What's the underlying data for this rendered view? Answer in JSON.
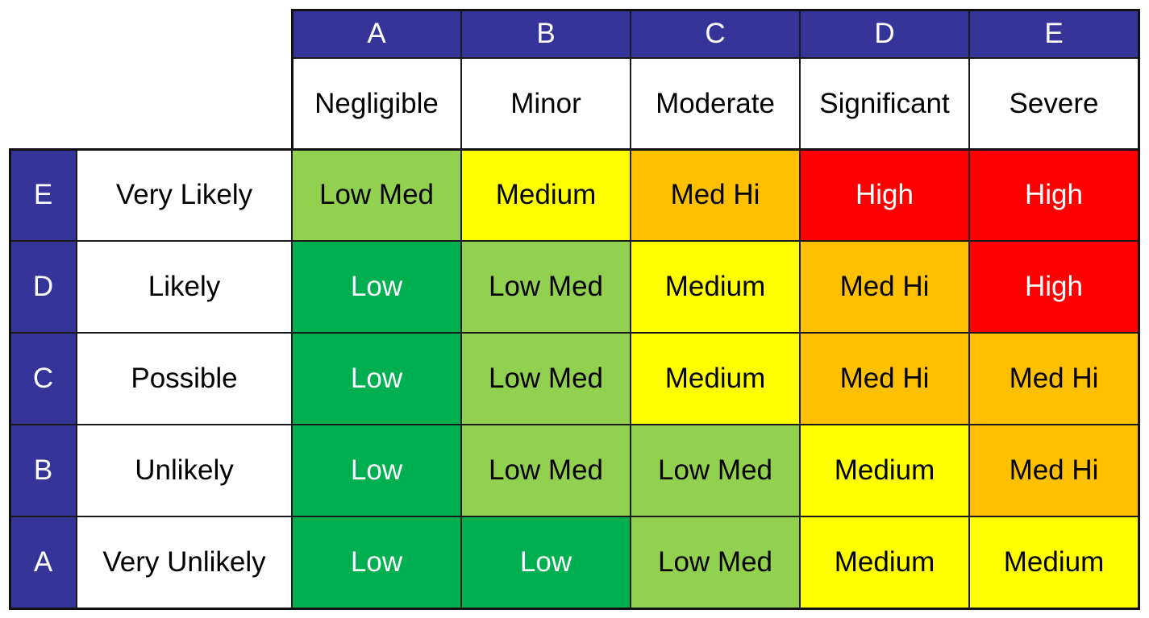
{
  "matrix": {
    "impact_codes": [
      "A",
      "B",
      "C",
      "D",
      "E"
    ],
    "impact_labels": [
      "Negligible",
      "Minor",
      "Moderate",
      "Significant",
      "Severe"
    ],
    "likelihood_rows": [
      {
        "code": "E",
        "label": "Very Likely",
        "cells": [
          "Low Med",
          "Medium",
          "Med Hi",
          "High",
          "High"
        ]
      },
      {
        "code": "D",
        "label": "Likely",
        "cells": [
          "Low",
          "Low Med",
          "Medium",
          "Med Hi",
          "High"
        ]
      },
      {
        "code": "C",
        "label": "Possible",
        "cells": [
          "Low",
          "Low Med",
          "Medium",
          "Med Hi",
          "Med Hi"
        ]
      },
      {
        "code": "B",
        "label": "Unlikely",
        "cells": [
          "Low",
          "Low Med",
          "Low Med",
          "Medium",
          "Med Hi"
        ]
      },
      {
        "code": "A",
        "label": "Very Unlikely",
        "cells": [
          "Low",
          "Low",
          "Low Med",
          "Medium",
          "Medium"
        ]
      }
    ]
  },
  "colors": {
    "header": "#353599",
    "levels": {
      "Low": {
        "bg": "#00B050",
        "fg": "#ffffff"
      },
      "Low Med": {
        "bg": "#92D050",
        "fg": "#000000"
      },
      "Medium": {
        "bg": "#FFFF00",
        "fg": "#000000"
      },
      "Med Hi": {
        "bg": "#FFC000",
        "fg": "#000000"
      },
      "High": {
        "bg": "#FF0000",
        "fg": "#ffffff"
      }
    }
  }
}
